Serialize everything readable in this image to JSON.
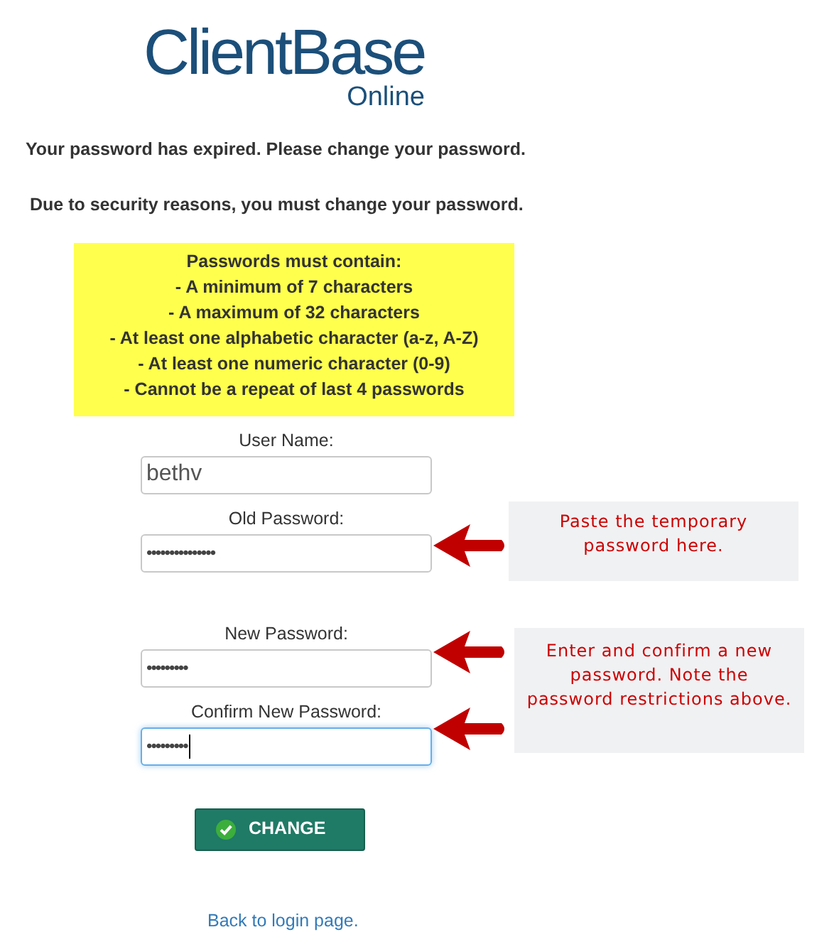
{
  "logo": {
    "name": "ClientBase",
    "sub": "Online"
  },
  "messages": [
    "Your password has expired. Please change your password.",
    "Due to security reasons, you must change your password."
  ],
  "requirements": {
    "title": "Passwords must contain:",
    "items": [
      "- A minimum of 7 characters",
      "- A maximum of 32 characters",
      "- At least one alphabetic character (a-z, A-Z)",
      "- At least one numeric character (0-9)",
      "- Cannot be a repeat of last 4 passwords"
    ]
  },
  "fields": [
    {
      "label": "User Name:",
      "value": "bethv",
      "focused": false
    },
    {
      "label": "Old Password:",
      "value": "•••••••••••••••",
      "focused": false
    },
    {
      "label": "New Password:",
      "value": "•••••••••",
      "focused": false
    },
    {
      "label": "Confirm New Password:",
      "value": "•••••••••",
      "focused": true
    }
  ],
  "callouts": [
    "Paste the temporary password here.",
    "Enter and confirm a new password.  Note the password restrictions above."
  ],
  "button": "CHANGE",
  "link": "Back to login page."
}
